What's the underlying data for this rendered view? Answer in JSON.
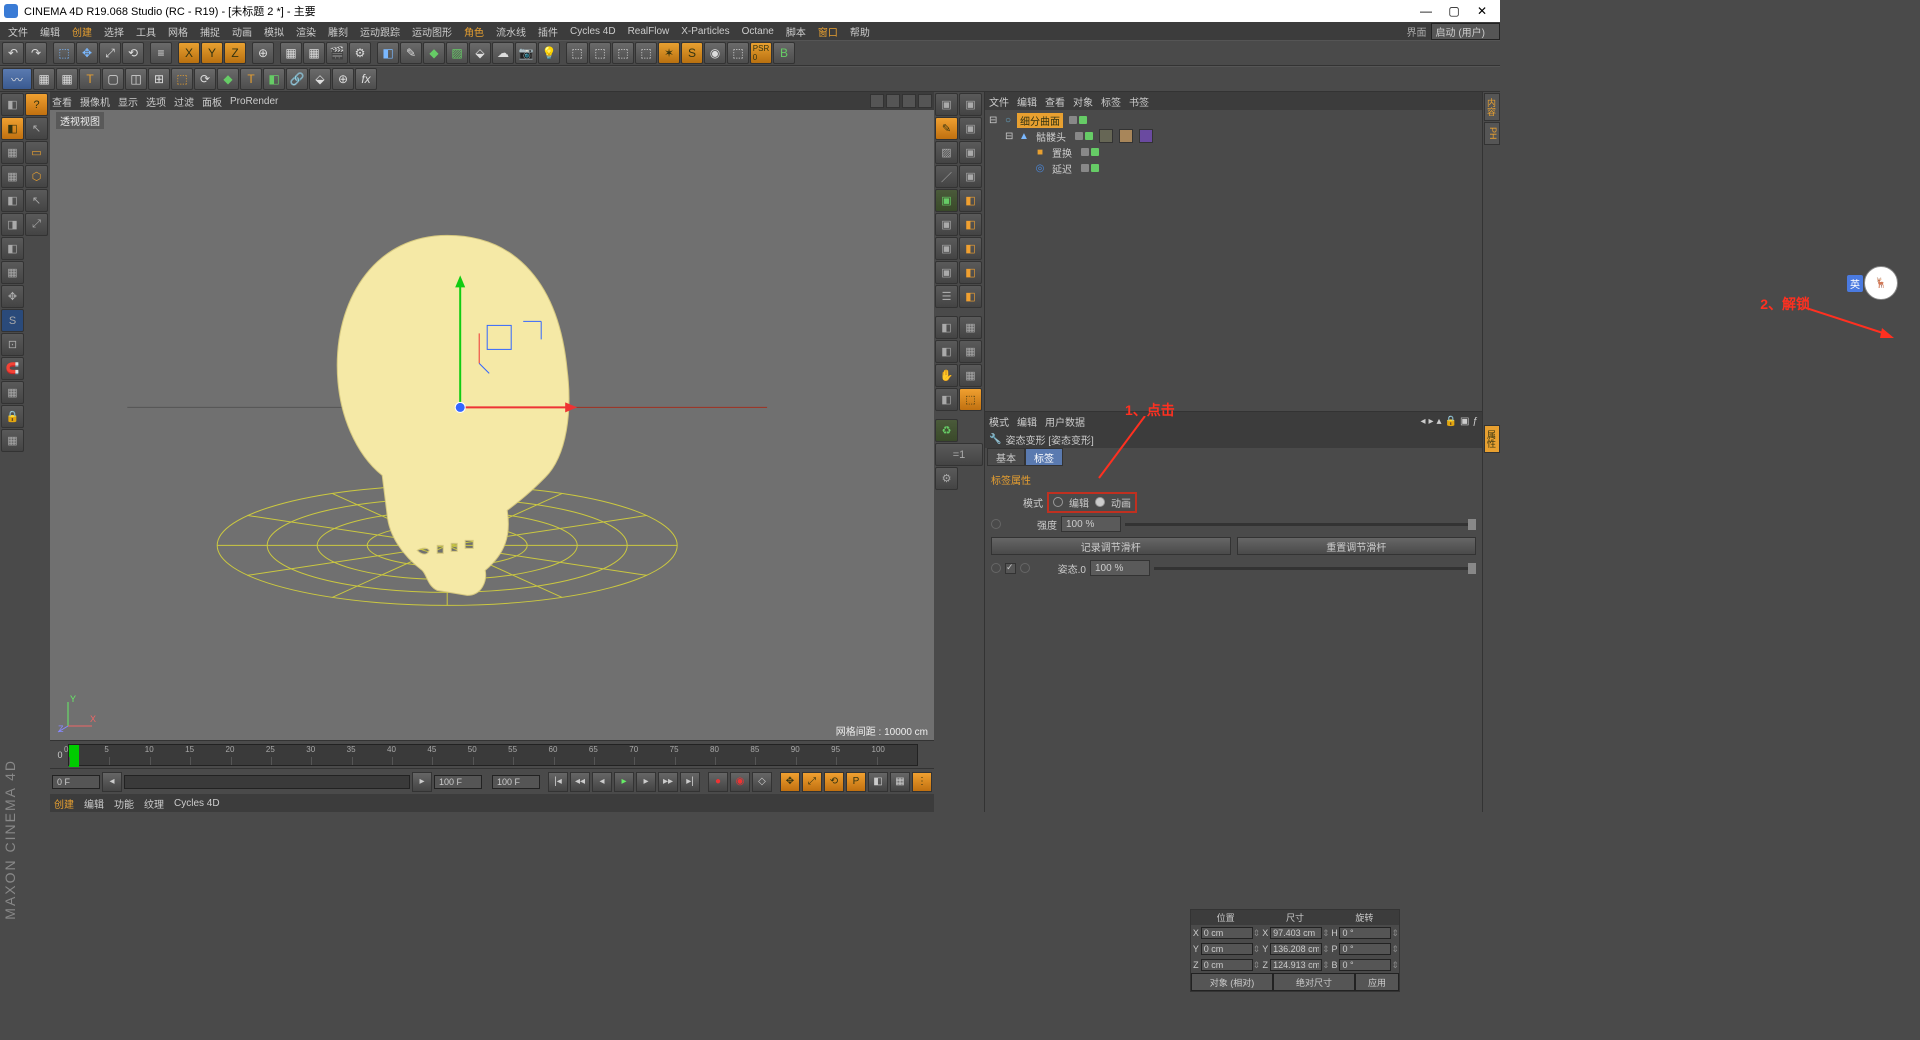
{
  "title": "CINEMA 4D R19.068 Studio (RC - R19) - [未标题 2 *] - 主要",
  "menubar": [
    "文件",
    "编辑",
    "创建",
    "选择",
    "工具",
    "网格",
    "捕捉",
    "动画",
    "模拟",
    "渲染",
    "雕刻",
    "运动跟踪",
    "运动图形",
    "角色",
    "流水线",
    "插件",
    "Cycles 4D",
    "RealFlow",
    "X-Particles",
    "Octane",
    "脚本",
    "窗口",
    "帮助"
  ],
  "layout": {
    "label": "界面",
    "value": "启动 (用户)"
  },
  "viewport": {
    "menu": [
      "查看",
      "摄像机",
      "显示",
      "选项",
      "过滤",
      "面板",
      "ProRender"
    ],
    "title": "透视视图",
    "status": "网格间距 : 10000 cm"
  },
  "objmgr": {
    "menu": [
      "文件",
      "编辑",
      "查看",
      "对象",
      "标签",
      "书签"
    ],
    "items": [
      {
        "name": "细分曲面",
        "indent": 0,
        "sel": true,
        "icon": "○",
        "iconColor": "#6ac"
      },
      {
        "name": "骷髅头",
        "indent": 1,
        "sel": false,
        "icon": "▲",
        "iconColor": "#7ab8ff",
        "tags": true
      },
      {
        "name": "置换",
        "indent": 2,
        "sel": false,
        "icon": "■",
        "iconColor": "#e8a030"
      },
      {
        "name": "延迟",
        "indent": 2,
        "sel": false,
        "icon": "◎",
        "iconColor": "#4a8ae0"
      }
    ]
  },
  "attr": {
    "menu": [
      "模式",
      "编辑",
      "用户数据"
    ],
    "title": "姿态变形 [姿态变形]",
    "tabs": [
      "基本",
      "标签"
    ],
    "active_tab": 1,
    "section": "标签属性",
    "mode_label": "模式",
    "mode_opts": [
      "编辑",
      "动画"
    ],
    "strength_label": "强度",
    "strength_value": "100 %",
    "btn_record": "记录调节滑杆",
    "btn_reset": "重置调节滑杆",
    "pose_label": "姿态.0",
    "pose_value": "100 %"
  },
  "annot1": "1、点击",
  "annot2": "2、解锁",
  "lang_badge": "英",
  "timeline": {
    "start": "0 F",
    "end": "100 F",
    "fps": "100 F",
    "cur": "0 F"
  },
  "ticks": [
    0,
    5,
    10,
    15,
    20,
    25,
    30,
    35,
    40,
    45,
    50,
    55,
    60,
    65,
    70,
    75,
    80,
    85,
    90,
    95,
    100
  ],
  "bottom_tabs": [
    "创建",
    "编辑",
    "功能",
    "纹理",
    "Cycles 4D"
  ],
  "coords": {
    "heads": [
      "位置",
      "尺寸",
      "旋转"
    ],
    "rows": [
      {
        "axis": "X",
        "p": "0 cm",
        "s": "97.403 cm",
        "r": "0 °",
        "sl": "H",
        "rl": "X"
      },
      {
        "axis": "Y",
        "p": "0 cm",
        "s": "136.208 cm",
        "r": "0 °",
        "sl": "P",
        "rl": "Y"
      },
      {
        "axis": "Z",
        "p": "0 cm",
        "s": "124.913 cm",
        "r": "0 °",
        "sl": "B",
        "rl": "Z"
      }
    ],
    "foot": [
      "对象 (相对)",
      "绝对尺寸",
      "应用"
    ]
  },
  "maxon": "MAXON CINEMA 4D"
}
